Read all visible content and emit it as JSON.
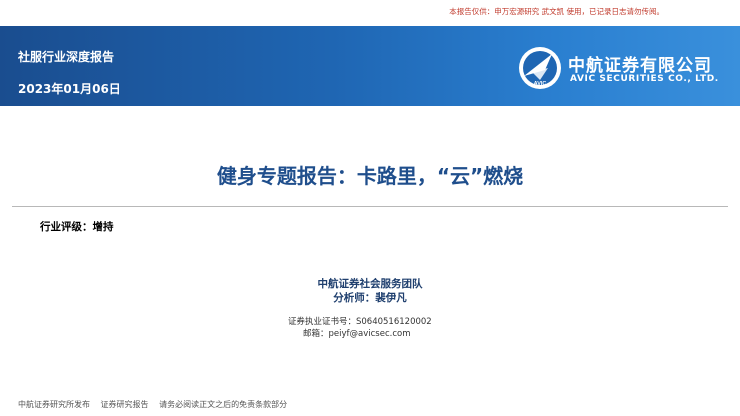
{
  "notice": "本报告仅供：申万宏源研究 武文凯 使用，已记录日志请勿传阅。",
  "banner": {
    "report_type": "社服行业深度报告",
    "date": "2023年01月06日",
    "logo_text": "AVIC",
    "company_cn": "中航证券有限公司",
    "company_en": "AVIC SECURITIES CO., LTD."
  },
  "title": "健身专题报告：卡路里，“云”燃烧",
  "rating": "行业评级：增持",
  "authors": {
    "team": "中航证券社会服务团队",
    "analyst": "分析师：裴伊凡",
    "certificate": "证券执业证书号：S0640516120002",
    "email": "邮箱：peiyf@avicsec.com"
  },
  "footer": {
    "publisher": "中航证券研究所发布",
    "doc_type": "证券研究报告",
    "disclaimer": "请务必阅读正文之后的免责条款部分"
  },
  "colors": {
    "banner_dark": "#1a4d8f",
    "banner_light": "#3a90dc",
    "title_blue": "#1f4e8c",
    "notice_red": "#c0392b"
  }
}
